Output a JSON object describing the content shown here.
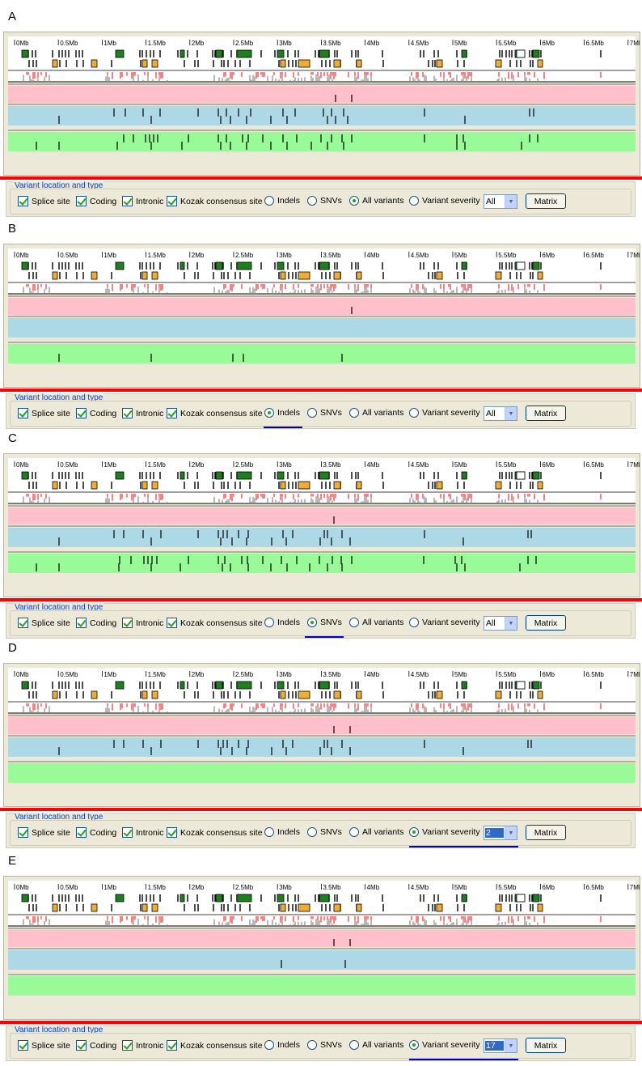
{
  "panels": [
    {
      "label": "A",
      "group_title": "Variant location and type",
      "selected": "All variants",
      "severity_value": "All",
      "pink": [
        [
          410,
          0
        ],
        [
          430,
          0
        ]
      ],
      "blue": [
        [
          136,
          0
        ],
        [
          150,
          0
        ],
        [
          172,
          0
        ],
        [
          193,
          0
        ],
        [
          240,
          0
        ],
        [
          265,
          0
        ],
        [
          275,
          0
        ],
        [
          290,
          0
        ],
        [
          305,
          0
        ],
        [
          345,
          0
        ],
        [
          360,
          0
        ],
        [
          395,
          0
        ],
        [
          405,
          0
        ],
        [
          420,
          0
        ],
        [
          520,
          0
        ],
        [
          650,
          0
        ],
        [
          655,
          0
        ],
        [
          68,
          1
        ],
        [
          182,
          1
        ],
        [
          268,
          1
        ],
        [
          280,
          1
        ],
        [
          300,
          1
        ],
        [
          330,
          1
        ],
        [
          350,
          1
        ],
        [
          400,
          1
        ],
        [
          410,
          1
        ],
        [
          425,
          1
        ],
        [
          570,
          1
        ]
      ],
      "green": [
        [
          148,
          0
        ],
        [
          160,
          0
        ],
        [
          175,
          0
        ],
        [
          180,
          0
        ],
        [
          185,
          0
        ],
        [
          190,
          0
        ],
        [
          228,
          0
        ],
        [
          265,
          0
        ],
        [
          275,
          0
        ],
        [
          295,
          0
        ],
        [
          302,
          0
        ],
        [
          320,
          0
        ],
        [
          345,
          0
        ],
        [
          362,
          0
        ],
        [
          392,
          0
        ],
        [
          405,
          0
        ],
        [
          418,
          0
        ],
        [
          430,
          0
        ],
        [
          520,
          0
        ],
        [
          560,
          0
        ],
        [
          568,
          0
        ],
        [
          650,
          0
        ],
        [
          660,
          0
        ],
        [
          40,
          1
        ],
        [
          68,
          1
        ],
        [
          140,
          1
        ],
        [
          182,
          1
        ],
        [
          220,
          1
        ],
        [
          268,
          1
        ],
        [
          280,
          1
        ],
        [
          300,
          1
        ],
        [
          330,
          1
        ],
        [
          350,
          1
        ],
        [
          380,
          1
        ],
        [
          400,
          1
        ],
        [
          420,
          1
        ],
        [
          560,
          1
        ],
        [
          570,
          1
        ],
        [
          640,
          1
        ]
      ]
    },
    {
      "label": "B",
      "group_title": "Variant location and type",
      "selected": "Indels",
      "severity_value": "All",
      "pink": [
        [
          430,
          0
        ]
      ],
      "blue": [],
      "green": [
        [
          68,
          1
        ],
        [
          182,
          1
        ],
        [
          283,
          1
        ],
        [
          296,
          1
        ],
        [
          418,
          1
        ]
      ]
    },
    {
      "label": "C",
      "group_title": "Variant location and type",
      "selected": "SNVs",
      "severity_value": "All",
      "pink": [
        [
          408,
          0
        ]
      ],
      "blue": [
        [
          136,
          0
        ],
        [
          148,
          0
        ],
        [
          172,
          0
        ],
        [
          194,
          0
        ],
        [
          240,
          0
        ],
        [
          265,
          0
        ],
        [
          271,
          0
        ],
        [
          276,
          0
        ],
        [
          290,
          0
        ],
        [
          302,
          0
        ],
        [
          345,
          0
        ],
        [
          357,
          0
        ],
        [
          396,
          0
        ],
        [
          400,
          0
        ],
        [
          418,
          0
        ],
        [
          520,
          0
        ],
        [
          648,
          0
        ],
        [
          652,
          0
        ],
        [
          68,
          1
        ],
        [
          182,
          1
        ],
        [
          268,
          1
        ],
        [
          282,
          1
        ],
        [
          300,
          1
        ],
        [
          331,
          1
        ],
        [
          349,
          1
        ],
        [
          391,
          1
        ],
        [
          405,
          1
        ],
        [
          428,
          1
        ],
        [
          568,
          1
        ]
      ],
      "green": [
        [
          143,
          0
        ],
        [
          157,
          0
        ],
        [
          173,
          0
        ],
        [
          178,
          0
        ],
        [
          183,
          0
        ],
        [
          189,
          0
        ],
        [
          228,
          0
        ],
        [
          265,
          0
        ],
        [
          273,
          0
        ],
        [
          294,
          0
        ],
        [
          301,
          0
        ],
        [
          320,
          0
        ],
        [
          343,
          0
        ],
        [
          362,
          0
        ],
        [
          390,
          0
        ],
        [
          406,
          0
        ],
        [
          417,
          0
        ],
        [
          430,
          0
        ],
        [
          519,
          0
        ],
        [
          558,
          0
        ],
        [
          566,
          0
        ],
        [
          648,
          0
        ],
        [
          658,
          0
        ],
        [
          40,
          1
        ],
        [
          68,
          1
        ],
        [
          142,
          1
        ],
        [
          182,
          1
        ],
        [
          218,
          1
        ],
        [
          270,
          1
        ],
        [
          280,
          1
        ],
        [
          302,
          1
        ],
        [
          330,
          1
        ],
        [
          350,
          1
        ],
        [
          378,
          1
        ],
        [
          400,
          1
        ],
        [
          418,
          1
        ],
        [
          560,
          1
        ],
        [
          570,
          1
        ],
        [
          638,
          1
        ]
      ]
    },
    {
      "label": "D",
      "group_title": "Variant location and type",
      "selected": "Variant severity",
      "severity_value": "2",
      "pink": [
        [
          408,
          0
        ],
        [
          428,
          0
        ]
      ],
      "blue": [
        [
          136,
          0
        ],
        [
          148,
          0
        ],
        [
          172,
          0
        ],
        [
          194,
          0
        ],
        [
          240,
          0
        ],
        [
          265,
          0
        ],
        [
          271,
          0
        ],
        [
          276,
          0
        ],
        [
          290,
          0
        ],
        [
          302,
          0
        ],
        [
          345,
          0
        ],
        [
          357,
          0
        ],
        [
          396,
          0
        ],
        [
          400,
          0
        ],
        [
          418,
          0
        ],
        [
          520,
          0
        ],
        [
          648,
          0
        ],
        [
          652,
          0
        ],
        [
          68,
          1
        ],
        [
          182,
          1
        ],
        [
          268,
          1
        ],
        [
          282,
          1
        ],
        [
          300,
          1
        ],
        [
          331,
          1
        ],
        [
          349,
          1
        ],
        [
          391,
          1
        ],
        [
          405,
          1
        ],
        [
          428,
          1
        ],
        [
          568,
          1
        ]
      ],
      "green": []
    },
    {
      "label": "E",
      "group_title": "Variant location and type",
      "selected": "Variant severity",
      "severity_value": "17",
      "pink": [
        [
          408,
          0
        ],
        [
          428,
          0
        ]
      ],
      "blue": [
        [
          343,
          1
        ],
        [
          422,
          1
        ]
      ],
      "green": []
    }
  ],
  "options": {
    "splice": "Splice site",
    "coding": "Coding",
    "intronic": "Intronic",
    "kozak": "Kozak consensus site",
    "indels": "Indels",
    "snvs": "SNVs",
    "all": "All variants",
    "severity": "Variant severity",
    "matrix": "Matrix"
  },
  "ruler": [
    "0Mb",
    "0.5Mb",
    "1Mb",
    "1.5Mb",
    "2Mb",
    "2.5Mb",
    "3Mb",
    "3.5Mb",
    "4Mb",
    "4.5Mb",
    "5Mb",
    "5.5Mb",
    "6Mb",
    "6.5Mb",
    "7Mb"
  ],
  "colors": {
    "pink": "#ffc0cb",
    "blue": "#add8e6",
    "green": "#98fb98",
    "exon": "#1f7f1f",
    "utr": "#f0ac33",
    "red": "#ff0000",
    "gray": "#888888"
  }
}
